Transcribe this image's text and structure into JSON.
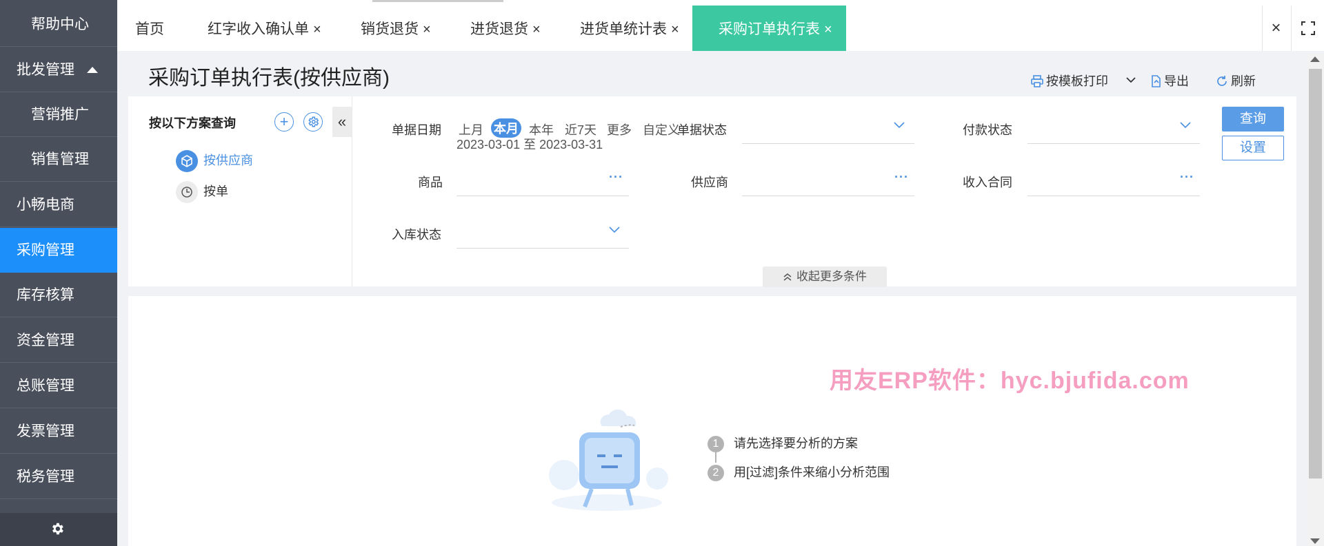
{
  "sidebar": {
    "items": [
      {
        "label": "帮助中心",
        "type": "sub"
      },
      {
        "label": "批发管理",
        "type": "group",
        "expanded": true
      },
      {
        "label": "营销推广",
        "type": "sub"
      },
      {
        "label": "销售管理",
        "type": "sub"
      },
      {
        "label": "小畅电商",
        "type": "main"
      },
      {
        "label": "采购管理",
        "type": "main",
        "active": true
      },
      {
        "label": "库存核算",
        "type": "main"
      },
      {
        "label": "资金管理",
        "type": "main"
      },
      {
        "label": "总账管理",
        "type": "main"
      },
      {
        "label": "发票管理",
        "type": "main"
      },
      {
        "label": "税务管理",
        "type": "main"
      }
    ],
    "bottom_icon": "gear-icon"
  },
  "tabs": [
    {
      "label": "首页",
      "closable": false
    },
    {
      "label": "红字收入确认单",
      "closable": true
    },
    {
      "label": "销货退货",
      "closable": true
    },
    {
      "label": "进货退货",
      "closable": true
    },
    {
      "label": "进货单统计表",
      "closable": true
    },
    {
      "label": "采购订单执行表",
      "closable": true,
      "active": true
    }
  ],
  "tab_close_symbol": "×",
  "page": {
    "title": "采购订单执行表(按供应商)",
    "toolbar": {
      "print_label": "按模板打印",
      "export_label": "导出",
      "refresh_label": "刷新"
    }
  },
  "scheme": {
    "title": "按以下方案查询",
    "add_symbol": "+",
    "collapse_symbol": "«",
    "items": [
      {
        "label": "按供应商",
        "selected": true,
        "icon": "cube-icon"
      },
      {
        "label": "按单",
        "selected": false,
        "icon": "clock-icon"
      }
    ]
  },
  "filters": {
    "date_label": "单据日期",
    "date_chips": [
      "上月",
      "本月",
      "本年",
      "近7天",
      "更多",
      "自定义"
    ],
    "date_chip_selected": "本月",
    "date_range": "2023-03-01 至 2023-03-31",
    "doc_status_label": "单据状态",
    "doc_status_value": "",
    "pay_status_label": "付款状态",
    "pay_status_value": "",
    "product_label": "商品",
    "product_value": "",
    "supplier_label": "供应商",
    "supplier_value": "",
    "contract_label": "收入合同",
    "contract_value": "",
    "stock_in_label": "入库状态",
    "stock_in_value": "",
    "more_symbol": "···",
    "query_label": "查询",
    "settings_label": "设置",
    "collapse_more_label": "收起更多条件"
  },
  "result": {
    "watermark": "用友ERP软件：hyc.bjufida.com",
    "steps": [
      {
        "num": "1",
        "text": "请先选择要分析的方案"
      },
      {
        "num": "2",
        "text": "用[过滤]条件来缩小分析范围"
      }
    ]
  },
  "colors": {
    "sidebar_bg": "#4a4f5c",
    "sidebar_active": "#1d8ffb",
    "tab_active": "#3cc8a0",
    "accent": "#4a90e2",
    "watermark": "#f59ec0"
  }
}
